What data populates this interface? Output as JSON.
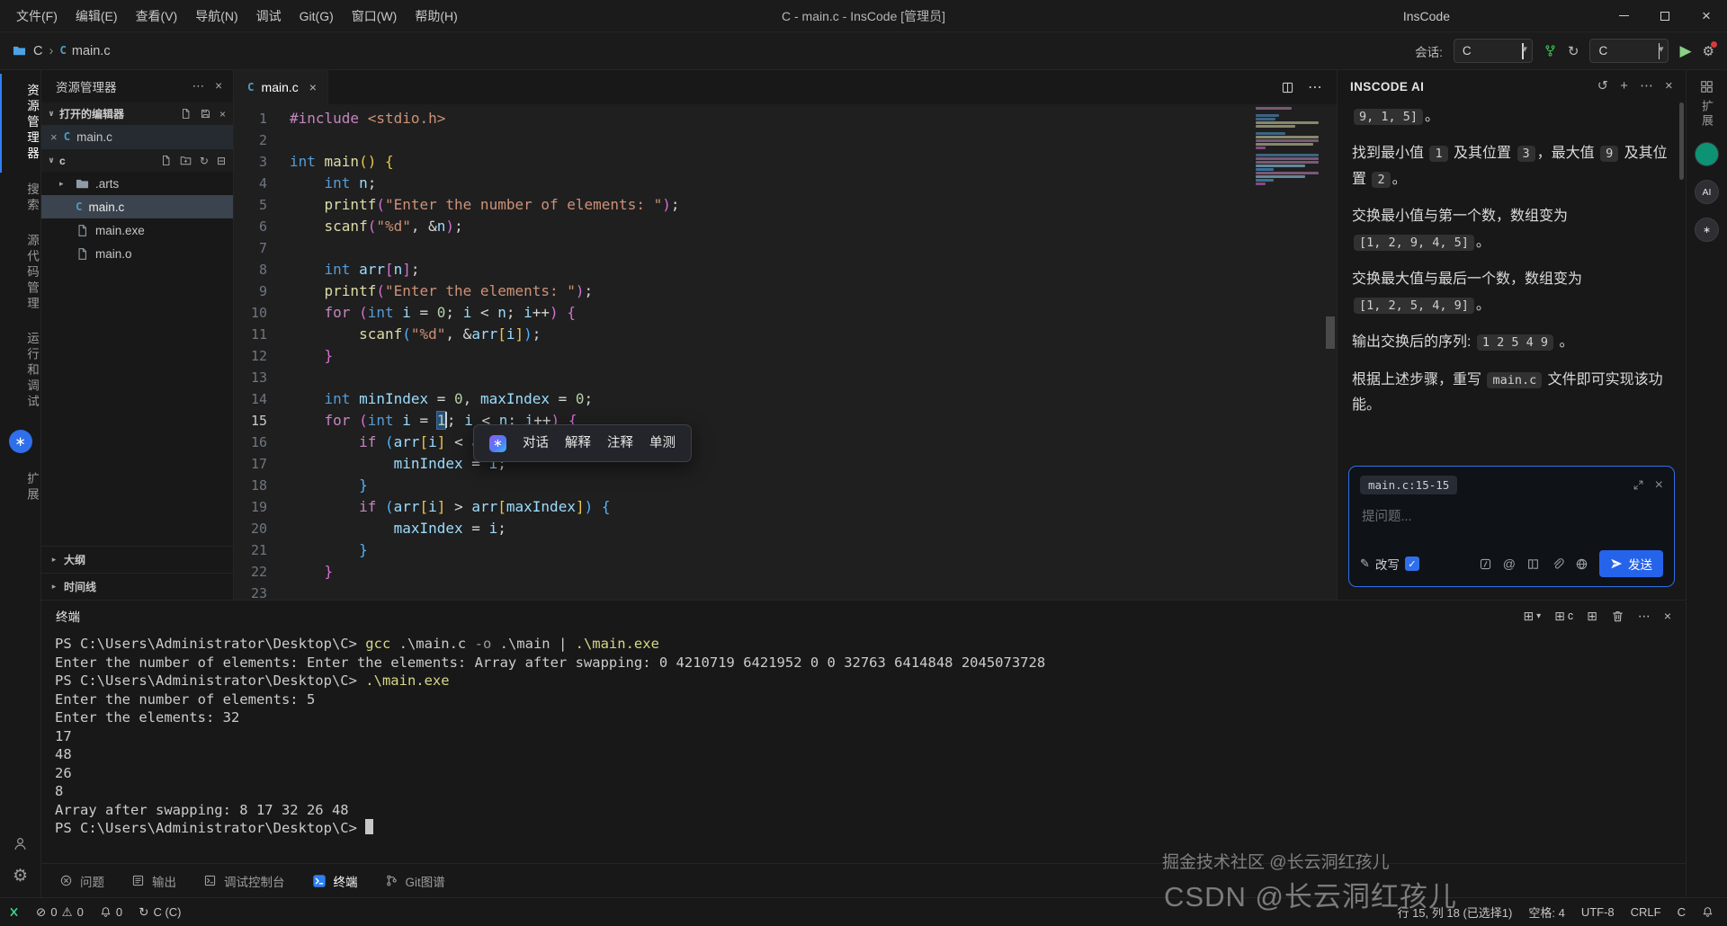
{
  "window": {
    "menus": [
      "文件(F)",
      "编辑(E)",
      "查看(V)",
      "导航(N)",
      "调试",
      "Git(G)",
      "窗口(W)",
      "帮助(H)"
    ],
    "title": "C - main.c - InsCode [管理员]",
    "app_name": "InsCode"
  },
  "toolbar": {
    "breadcrumb": [
      "C",
      "main.c"
    ],
    "session_label": "会话:",
    "session_value": "C",
    "target_value": "C"
  },
  "activity_left": {
    "items": [
      {
        "label": "资源管理器",
        "active": true
      },
      {
        "label": "搜索"
      },
      {
        "label": "源代码管理"
      },
      {
        "label": "运行和调试"
      },
      {
        "type": "ai-button"
      },
      {
        "label": "扩展"
      }
    ]
  },
  "activity_right": {
    "label": "扩展",
    "circles": [
      {
        "name": "plugin-circle-teal",
        "bg": "#0d9373",
        "text": ""
      },
      {
        "name": "plugin-circle-ai",
        "bg": "#2e2e33",
        "text": "AI"
      },
      {
        "name": "plugin-circle-dark",
        "bg": "#2e2e33",
        "text": "∗"
      }
    ]
  },
  "sidebar": {
    "title": "资源管理器",
    "open_editors_label": "打开的编辑器",
    "open_editors": [
      {
        "name": "main.c"
      }
    ],
    "root_label": "c",
    "tree": [
      {
        "name": ".arts",
        "kind": "folder"
      },
      {
        "name": "main.c",
        "kind": "c",
        "selected": true
      },
      {
        "name": "main.exe",
        "kind": "file"
      },
      {
        "name": "main.o",
        "kind": "file"
      }
    ],
    "bottom_sections": [
      "大纲",
      "时间线"
    ]
  },
  "editor": {
    "tab_name": "main.c",
    "active_line": 15,
    "popup_items": [
      "对话",
      "解释",
      "注释",
      "单测"
    ],
    "code": [
      [
        [
          "ctrl",
          "#include "
        ],
        [
          "str",
          "<stdio.h>"
        ]
      ],
      [],
      [
        [
          "kw",
          "int "
        ],
        [
          "fn",
          "main"
        ],
        [
          "b1",
          "()"
        ],
        [
          "pl",
          " "
        ],
        [
          "b1",
          "{"
        ]
      ],
      [
        [
          "pl",
          "    "
        ],
        [
          "kw",
          "int "
        ],
        [
          "var",
          "n"
        ],
        [
          "pl",
          ";"
        ]
      ],
      [
        [
          "pl",
          "    "
        ],
        [
          "fn",
          "printf"
        ],
        [
          "b2",
          "("
        ],
        [
          "str",
          "\"Enter the number of elements: \""
        ],
        [
          "b2",
          ")"
        ],
        [
          "pl",
          ";"
        ]
      ],
      [
        [
          "pl",
          "    "
        ],
        [
          "fn",
          "scanf"
        ],
        [
          "b2",
          "("
        ],
        [
          "str",
          "\"%d\""
        ],
        [
          "pl",
          ", &"
        ],
        [
          "var",
          "n"
        ],
        [
          "b2",
          ")"
        ],
        [
          "pl",
          ";"
        ]
      ],
      [],
      [
        [
          "pl",
          "    "
        ],
        [
          "kw",
          "int "
        ],
        [
          "var",
          "arr"
        ],
        [
          "b2",
          "["
        ],
        [
          "var",
          "n"
        ],
        [
          "b2",
          "]"
        ],
        [
          "pl",
          ";"
        ]
      ],
      [
        [
          "pl",
          "    "
        ],
        [
          "fn",
          "printf"
        ],
        [
          "b2",
          "("
        ],
        [
          "str",
          "\"Enter the elements: \""
        ],
        [
          "b2",
          ")"
        ],
        [
          "pl",
          ";"
        ]
      ],
      [
        [
          "pl",
          "    "
        ],
        [
          "ctrl",
          "for "
        ],
        [
          "b2",
          "("
        ],
        [
          "kw",
          "int "
        ],
        [
          "var",
          "i"
        ],
        [
          "pl",
          " = "
        ],
        [
          "num",
          "0"
        ],
        [
          "pl",
          "; "
        ],
        [
          "var",
          "i"
        ],
        [
          "pl",
          " < "
        ],
        [
          "var",
          "n"
        ],
        [
          "pl",
          "; "
        ],
        [
          "var",
          "i"
        ],
        [
          "pl",
          "++"
        ],
        [
          "b2",
          ")"
        ],
        [
          "pl",
          " "
        ],
        [
          "b2",
          "{"
        ]
      ],
      [
        [
          "pl",
          "        "
        ],
        [
          "fn",
          "scanf"
        ],
        [
          "b3",
          "("
        ],
        [
          "str",
          "\"%d\""
        ],
        [
          "pl",
          ", &"
        ],
        [
          "var",
          "arr"
        ],
        [
          "b1",
          "["
        ],
        [
          "var",
          "i"
        ],
        [
          "b1",
          "]"
        ],
        [
          "b3",
          ")"
        ],
        [
          "pl",
          ";"
        ]
      ],
      [
        [
          "pl",
          "    "
        ],
        [
          "b2",
          "}"
        ]
      ],
      [],
      [
        [
          "pl",
          "    "
        ],
        [
          "kw",
          "int "
        ],
        [
          "var",
          "minIndex"
        ],
        [
          "pl",
          " = "
        ],
        [
          "num",
          "0"
        ],
        [
          "pl",
          ", "
        ],
        [
          "var",
          "maxIndex"
        ],
        [
          "pl",
          " = "
        ],
        [
          "num",
          "0"
        ],
        [
          "pl",
          ";"
        ]
      ],
      [
        [
          "pl",
          "    "
        ],
        [
          "ctrl",
          "for "
        ],
        [
          "b2",
          "("
        ],
        [
          "kw",
          "int "
        ],
        [
          "var",
          "i"
        ],
        [
          "pl",
          " = "
        ],
        [
          "num",
          "1",
          1
        ],
        [
          "pl",
          "; "
        ],
        [
          "var",
          "i"
        ],
        [
          "pl",
          " < "
        ],
        [
          "var",
          "n"
        ],
        [
          "pl",
          "; "
        ],
        [
          "var",
          "i"
        ],
        [
          "pl",
          "++"
        ],
        [
          "b2",
          ")"
        ],
        [
          "pl",
          " "
        ],
        [
          "b2",
          "{"
        ]
      ],
      [
        [
          "pl",
          "        "
        ],
        [
          "ctrl",
          "if "
        ],
        [
          "b3",
          "("
        ],
        [
          "var",
          "arr"
        ],
        [
          "b1",
          "["
        ],
        [
          "var",
          "i"
        ],
        [
          "b1",
          "]"
        ],
        [
          "pl",
          " < "
        ],
        [
          "var",
          "arr"
        ],
        [
          "b1",
          "["
        ],
        [
          "var",
          "minIndex"
        ],
        [
          "b1",
          "]"
        ],
        [
          "b3",
          ")"
        ],
        [
          "pl",
          " "
        ],
        [
          "b3",
          "{"
        ]
      ],
      [
        [
          "pl",
          "            "
        ],
        [
          "var",
          "minIndex"
        ],
        [
          "pl",
          " = "
        ],
        [
          "var",
          "i"
        ],
        [
          "pl",
          ";"
        ]
      ],
      [
        [
          "pl",
          "        "
        ],
        [
          "b3",
          "}"
        ]
      ],
      [
        [
          "pl",
          "        "
        ],
        [
          "ctrl",
          "if "
        ],
        [
          "b3",
          "("
        ],
        [
          "var",
          "arr"
        ],
        [
          "b1",
          "["
        ],
        [
          "var",
          "i"
        ],
        [
          "b1",
          "]"
        ],
        [
          "pl",
          " > "
        ],
        [
          "var",
          "arr"
        ],
        [
          "b1",
          "["
        ],
        [
          "var",
          "maxIndex"
        ],
        [
          "b1",
          "]"
        ],
        [
          "b3",
          ")"
        ],
        [
          "pl",
          " "
        ],
        [
          "b3",
          "{"
        ]
      ],
      [
        [
          "pl",
          "            "
        ],
        [
          "var",
          "maxIndex"
        ],
        [
          "pl",
          " = "
        ],
        [
          "var",
          "i"
        ],
        [
          "pl",
          ";"
        ]
      ],
      [
        [
          "pl",
          "        "
        ],
        [
          "b3",
          "}"
        ]
      ],
      [
        [
          "pl",
          "    "
        ],
        [
          "b2",
          "}"
        ]
      ],
      []
    ]
  },
  "ai_panel": {
    "title": "INSCODE AI",
    "messages": [
      [
        [
          "c",
          "9, 1, 5]"
        ],
        [
          "t",
          "。"
        ]
      ],
      [
        [
          "t",
          "找到最小值 "
        ],
        [
          "c",
          "1"
        ],
        [
          "t",
          " 及其位置 "
        ],
        [
          "c",
          "3"
        ],
        [
          "t",
          "，最大值 "
        ],
        [
          "c",
          "9"
        ],
        [
          "t",
          " 及其位置 "
        ],
        [
          "c",
          "2"
        ],
        [
          "t",
          "。"
        ]
      ],
      [
        [
          "t",
          "交换最小值与第一个数，数组变为 "
        ],
        [
          "c",
          "[1, 2, 9, 4, 5]"
        ],
        [
          "t",
          "。"
        ]
      ],
      [
        [
          "t",
          "交换最大值与最后一个数，数组变为 "
        ],
        [
          "c",
          "[1, 2, 5, 4, 9]"
        ],
        [
          "t",
          "。"
        ]
      ],
      [
        [
          "t",
          "输出交换后的序列: "
        ],
        [
          "c",
          "1 2 5 4 9"
        ],
        [
          "t",
          " 。"
        ]
      ],
      [
        [
          "t",
          "根据上述步骤，重写 "
        ],
        [
          "c",
          "main.c"
        ],
        [
          "t",
          " 文件即可实现该功能。"
        ]
      ]
    ],
    "input": {
      "context": "main.c:15-15",
      "placeholder": "提问题...",
      "rewrite_label": "改写",
      "send_label": "发送",
      "tools": [
        "slash-icon",
        "mention-icon",
        "library-icon",
        "attach-icon",
        "globe-icon"
      ]
    }
  },
  "terminal": {
    "title": "终端",
    "profile_letter": "c",
    "lines": [
      [
        [
          "w",
          "PS C:\\Users\\Administrator\\Desktop\\C> "
        ],
        [
          "y",
          "gcc"
        ],
        [
          "w",
          " .\\main.c "
        ],
        [
          "p",
          "-o"
        ],
        [
          "w",
          " .\\main "
        ],
        [
          "w",
          "| "
        ],
        [
          "y",
          ".\\main.exe"
        ]
      ],
      [
        [
          "w",
          "Enter the number of elements: Enter the elements: Array after swapping: 0 4210719 6421952 0 0 32763 6414848 2045073728"
        ]
      ],
      [
        [
          "w",
          "PS C:\\Users\\Administrator\\Desktop\\C> "
        ],
        [
          "y",
          ".\\main.exe"
        ]
      ],
      [
        [
          "w",
          "Enter the number of elements: 5"
        ]
      ],
      [
        [
          "w",
          "Enter the elements: 32"
        ]
      ],
      [
        [
          "w",
          "17"
        ]
      ],
      [
        [
          "w",
          "48"
        ]
      ],
      [
        [
          "w",
          "26"
        ]
      ],
      [
        [
          "w",
          "8"
        ]
      ],
      [
        [
          "w",
          "Array after swapping: 8 17 32 26 48"
        ]
      ],
      [
        [
          "w",
          "PS C:\\Users\\Administrator\\Desktop\\C> "
        ],
        [
          "cur",
          ""
        ]
      ]
    ]
  },
  "panel_tabs": [
    {
      "label": "问题",
      "icon": "problems"
    },
    {
      "label": "输出",
      "icon": "output"
    },
    {
      "label": "调试控制台",
      "icon": "debug-console"
    },
    {
      "label": "终端",
      "icon": "terminal",
      "active": true
    },
    {
      "label": "Git图谱",
      "icon": "git-graph"
    }
  ],
  "status_bar": {
    "errors": "0",
    "warnings": "0",
    "bell_count": "0",
    "run_config": "C (C)",
    "cursor": "行 15, 列 18 (已选择1)",
    "indent": "空格: 4",
    "encoding": "UTF-8",
    "eol": "CRLF",
    "language": "C"
  },
  "watermarks": {
    "small": "掘金技术社区 @长云洞红孩儿",
    "large": "CSDN @长云洞红孩儿"
  },
  "icons": {
    "close-icon": "×",
    "more-icon": "⋯",
    "chevron-down-icon": "∨",
    "chevron-right-icon": "▸",
    "caret-down-icon": "▾",
    "plus-icon": "+",
    "history-icon": "↺",
    "refresh-icon": "↻",
    "error-icon": "⊘",
    "warning-icon": "⚠",
    "gear-icon": "⚙",
    "play-icon": "▶",
    "check-icon": "✓",
    "mention-icon": "@",
    "pencil-icon": "✎",
    "sparkle-icon": "∗",
    "panel-icon": "⊞",
    "collapse-all-icon": "⊟",
    "folder-icon": "svg",
    "file-icon": "svg",
    "trash-icon": "svg",
    "bell-icon": "svg",
    "attach-icon": "svg",
    "library-icon": "svg",
    "globe-icon": "svg",
    "send-icon": "svg",
    "slash-icon": "svg",
    "fork-icon": "svg",
    "person-icon": "svg",
    "problems-icon": "svg",
    "output-icon": "svg",
    "debug-console-icon": "svg",
    "terminal-icon": "svg",
    "git-graph-icon": "svg",
    "expand-icon": "svg",
    "new-file-icon": "svg",
    "new-folder-icon": "svg",
    "save-all-icon": "svg",
    "split-editor-icon": "svg",
    "extensions-icon": "svg",
    "remote-icon": "svg"
  }
}
